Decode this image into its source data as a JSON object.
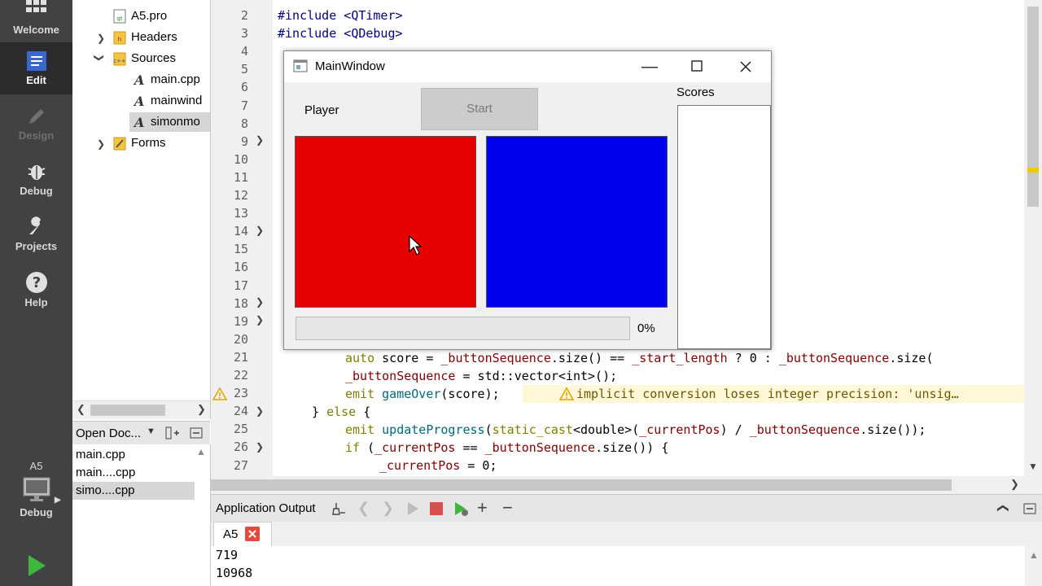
{
  "modes": [
    {
      "label": "Welcome",
      "icon": "grid-icon"
    },
    {
      "label": "Edit",
      "icon": "edit-icon"
    },
    {
      "label": "Design",
      "icon": "pencil-icon"
    },
    {
      "label": "Debug",
      "icon": "bug-icon"
    },
    {
      "label": "Projects",
      "icon": "wrench-icon"
    },
    {
      "label": "Help",
      "icon": "help-icon"
    }
  ],
  "kit": {
    "project": "A5",
    "mode": "Debug"
  },
  "tree": {
    "pro": "A5.pro",
    "headers": "Headers",
    "sources": "Sources",
    "src1": "main.cpp",
    "src2": "mainwind",
    "src3": "simonmo",
    "forms": "Forms"
  },
  "opendocs": {
    "title": "Open Doc...",
    "items": [
      "main.cpp",
      "main....cpp",
      "simo....cpp"
    ]
  },
  "code": {
    "ln": [
      "2",
      "3",
      "4",
      "5",
      "6",
      "7",
      "8",
      "9",
      "10",
      "11",
      "12",
      "13",
      "14",
      "15",
      "16",
      "17",
      "18",
      "19",
      "20",
      "21",
      "22",
      "23",
      "24",
      "25",
      "26",
      "27"
    ],
    "l2": "QTimer",
    "l3": "QDebug",
    "l21a": "auto",
    "l21b": " score = ",
    "l21c": "_buttonSequence",
    "l21d": ".size() == ",
    "l21e": "_start_length",
    "l21f": " ? 0 : ",
    "l21g": "_buttonSequence",
    "l21h": ".size(",
    "l22a": "_buttonSequence",
    "l22b": " = std::vector<int>();",
    "l23a": "emit ",
    "l23b": "gameOver",
    "l23c": "(score);",
    "warning": "implicit conversion loses integer precision: 'unsig…",
    "l24a": "} ",
    "l24b": "else",
    "l24c": " {",
    "l25a": "emit ",
    "l25b": "updateProgress",
    "l25c": "(",
    "l25d": "static_cast",
    "l25e": "<double>(",
    "l25f": "_currentPos",
    "l25g": ") / ",
    "l25h": "_buttonSequence",
    "l25i": ".size());",
    "l26a": "if",
    "l26b": " (",
    "l26c": "_currentPos",
    "l26d": " == ",
    "l26e": "_buttonSequence",
    "l26f": ".size()) {",
    "l27a": "_currentPos",
    "l27b": " = 0;"
  },
  "output": {
    "title": "Application Output",
    "tab": "A5",
    "lines": [
      "719",
      "10968"
    ]
  },
  "window": {
    "title": "MainWindow",
    "player_label": "Player",
    "start_label": "Start",
    "scores_label": "Scores",
    "progress_text": "0%",
    "progress_value": 0,
    "left_color": "#e60000",
    "right_color": "#0000f0"
  }
}
